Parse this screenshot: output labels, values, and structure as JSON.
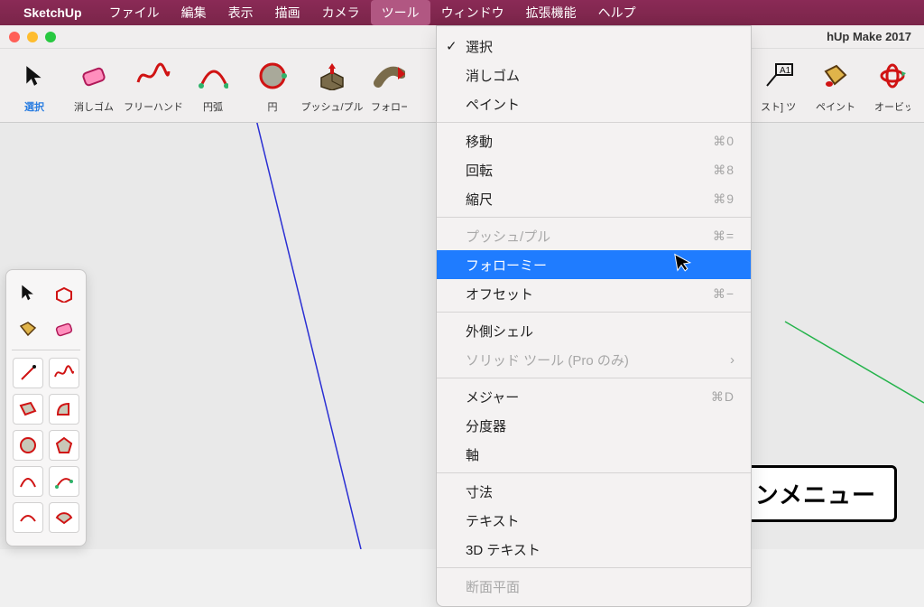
{
  "menubar": {
    "app": "SketchUp",
    "items": [
      "ファイル",
      "編集",
      "表示",
      "描画",
      "カメラ",
      "ツール",
      "ウィンドウ",
      "拡張機能",
      "ヘルプ"
    ],
    "active_index": 5
  },
  "window": {
    "title": "hUp Make 2017"
  },
  "toolbar": {
    "items": [
      {
        "label": "選択",
        "selected": true
      },
      {
        "label": "消しゴム"
      },
      {
        "label": "フリーハンド"
      },
      {
        "label": "円弧"
      },
      {
        "label": "円"
      },
      {
        "label": "プッシュ/プル"
      },
      {
        "label": "フォローミ"
      },
      {
        "label": "スト] ツール"
      },
      {
        "label": "ペイント"
      },
      {
        "label": "オービッ"
      }
    ]
  },
  "dropmenu": {
    "groups": [
      [
        {
          "label": "選択",
          "checked": true
        },
        {
          "label": "消しゴム"
        },
        {
          "label": "ペイント"
        }
      ],
      [
        {
          "label": "移動",
          "shortcut": "⌘0"
        },
        {
          "label": "回転",
          "shortcut": "⌘8"
        },
        {
          "label": "縮尺",
          "shortcut": "⌘9"
        }
      ],
      [
        {
          "label": "プッシュ/プル",
          "shortcut": "⌘=",
          "disabled": true
        },
        {
          "label": "フォローミー",
          "highlighted": true
        },
        {
          "label": "オフセット",
          "shortcut": "⌘−"
        }
      ],
      [
        {
          "label": "外側シェル"
        },
        {
          "label": "ソリッド ツール (Pro のみ)",
          "disabled": true,
          "submenu": true
        }
      ],
      [
        {
          "label": "メジャー",
          "shortcut": "⌘D"
        },
        {
          "label": "分度器"
        },
        {
          "label": "軸"
        }
      ],
      [
        {
          "label": "寸法"
        },
        {
          "label": "テキスト"
        },
        {
          "label": "3D テキスト"
        }
      ],
      [
        {
          "label": "断面平面",
          "disabled": true
        }
      ]
    ]
  },
  "callout": {
    "text": "アプリケーションメニュー"
  },
  "colors": {
    "menubar_bg": "#7a2549",
    "highlight": "#1f7cff",
    "blue_axis": "#2a2fd3",
    "green_axis": "#24b34b"
  }
}
